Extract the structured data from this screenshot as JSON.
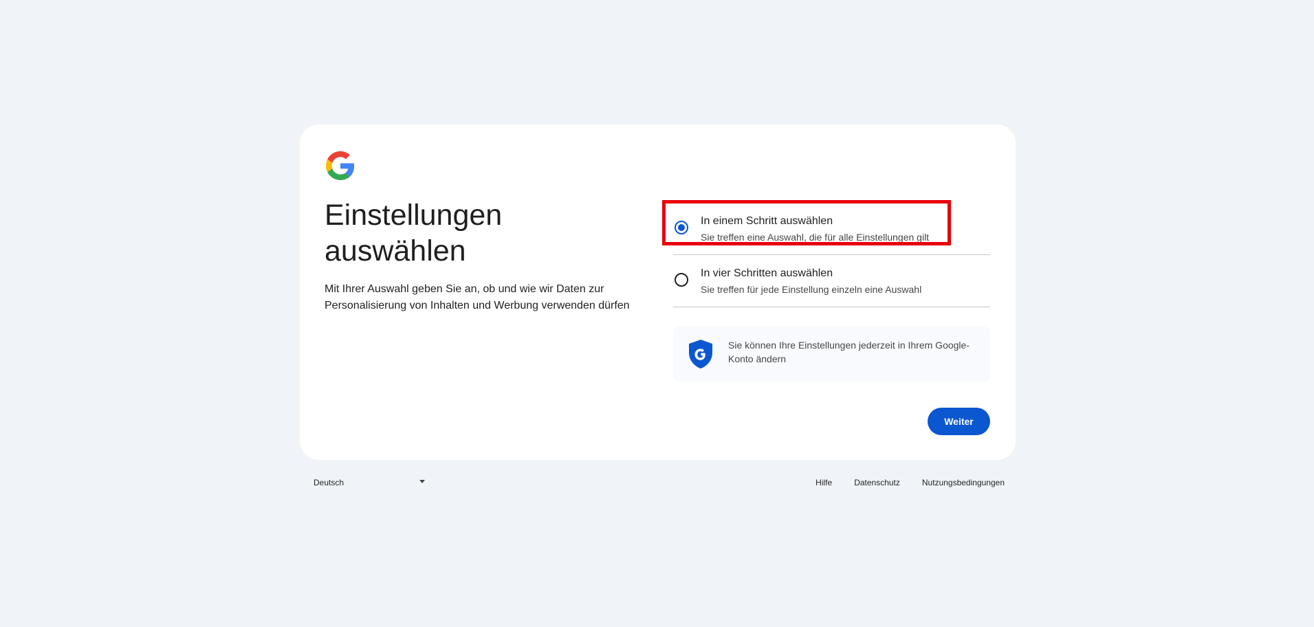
{
  "card": {
    "title": "Einstellungen auswählen",
    "description": "Mit Ihrer Auswahl geben Sie an, ob und wie wir Daten zur Personalisierung von Inhalten und Werbung verwenden dürfen"
  },
  "options": [
    {
      "title": "In einem Schritt auswählen",
      "subtitle": "Sie treffen eine Auswahl, die für alle Einstellungen gilt",
      "selected": true
    },
    {
      "title": "In vier Schritten auswählen",
      "subtitle": "Sie treffen für jede Einstellung einzeln eine Auswahl",
      "selected": false
    }
  ],
  "info": {
    "text": "Sie können Ihre Einstellungen jederzeit in Ihrem Google-Konto ändern"
  },
  "buttons": {
    "next_label": "Weiter"
  },
  "footer": {
    "language": "Deutsch",
    "links": [
      "Hilfe",
      "Datenschutz",
      "Nutzungsbedingungen"
    ]
  },
  "colors": {
    "background": "#f0f4f9",
    "accent": "#0b57d0",
    "highlight": "#e8000b"
  },
  "icons": {
    "logo": "google-g-logo",
    "shield": "shield-g-icon",
    "dropdown": "caret-down-icon"
  }
}
